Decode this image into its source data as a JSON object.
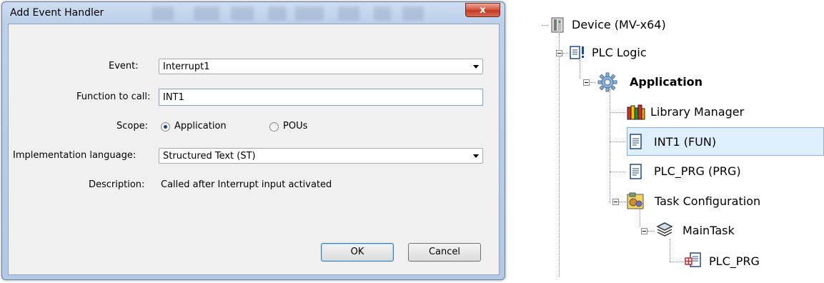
{
  "dialog": {
    "title": "Add Event Handler",
    "close_glyph": "x",
    "event_label": "Event:",
    "event_value": "Interrupt1",
    "function_label": "Function to call:",
    "function_value": "INT1",
    "scope_label": "Scope:",
    "scope_options": [
      {
        "label": "Application",
        "selected": true
      },
      {
        "label": "POUs",
        "selected": false
      }
    ],
    "language_label": "Implementation language:",
    "language_value": "Structured Text (ST)",
    "description_label": "Description:",
    "description_value": "Called after Interrupt input activated",
    "ok_label": "OK",
    "cancel_label": "Cancel"
  },
  "tree": {
    "nodes": [
      {
        "label": "Device (MV-x64)",
        "icon": "device-icon"
      },
      {
        "label": "PLC Logic",
        "icon": "plc-logic-icon"
      },
      {
        "label": "Application",
        "icon": "gear-icon"
      },
      {
        "label": "Library Manager",
        "icon": "library-books-icon"
      },
      {
        "label": "INT1 (FUN)",
        "icon": "pou-document-icon",
        "selected": true
      },
      {
        "label": "PLC_PRG (PRG)",
        "icon": "pou-document-icon"
      },
      {
        "label": "Task Configuration",
        "icon": "task-configuration-icon"
      },
      {
        "label": "MainTask",
        "icon": "task-stack-icon"
      },
      {
        "label": "PLC_PRG",
        "icon": "program-call-icon"
      }
    ]
  },
  "colors": {
    "accent": "#3c7fb1",
    "selection": "#dfeefb",
    "titlebar": "#bcd0ea",
    "close": "#c23a22"
  }
}
